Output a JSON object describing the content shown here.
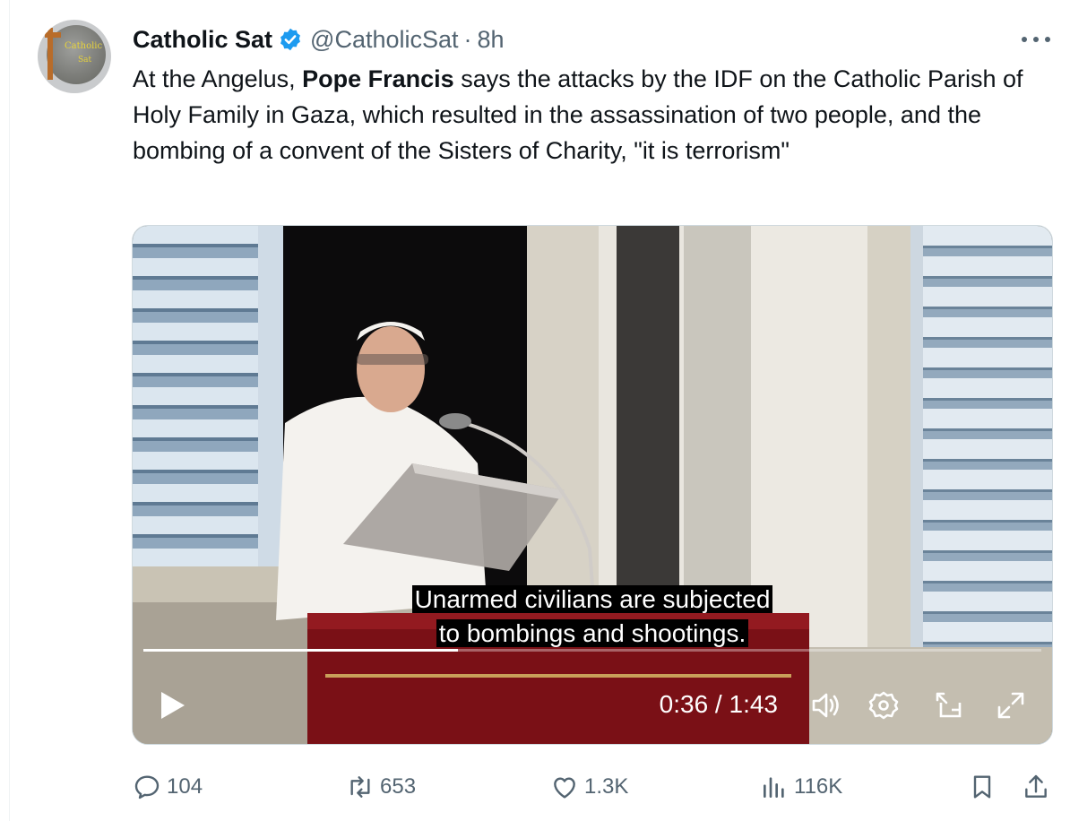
{
  "tweet": {
    "author_name": "Catholic Sat",
    "verified": true,
    "handle": "@CatholicSat",
    "separator": "·",
    "time": "8h",
    "avatar": {
      "text_line1": "Catholic",
      "text_line2": "Sat"
    },
    "text_before_bold": "At the Angelus, ",
    "text_bold": "Pope Francis",
    "text_after_bold": " says the attacks by the IDF on the Catholic Parish of Holy Family in Gaza, which resulted in the assassination of two people, and the bombing of a convent of the Sisters of Charity, \"it is terrorism\""
  },
  "video": {
    "caption_line1": "Unarmed civilians are subjected",
    "caption_line2": "to bombings and shootings.",
    "time_display": "0:36 / 1:43",
    "progress_fraction": 0.35,
    "controls": [
      "play-icon",
      "volume-icon",
      "settings-icon",
      "picture-in-picture-icon",
      "fullscreen-icon"
    ]
  },
  "actions": {
    "replies": "104",
    "reposts": "653",
    "likes": "1.3K",
    "views": "116K"
  },
  "colors": {
    "text_primary": "#0f1419",
    "text_secondary": "#536471",
    "verified_blue": "#1d9bf0",
    "border": "#cfd9de"
  }
}
